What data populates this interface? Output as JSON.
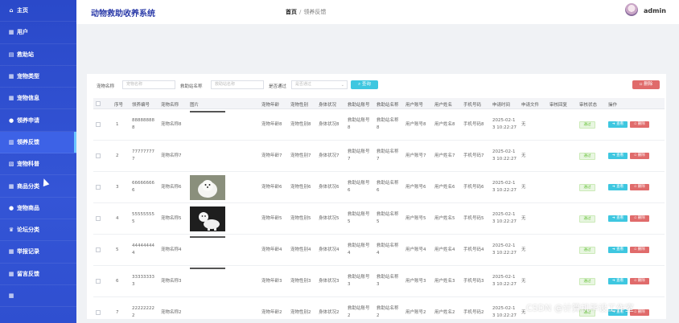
{
  "header": {
    "system_title": "动物救助收养系统",
    "breadcrumb_home": "首页",
    "breadcrumb_sep": "/",
    "breadcrumb_current": "领养反馈",
    "username": "admin"
  },
  "sidebar": {
    "items": [
      {
        "label": "主页",
        "icon": "home-icon"
      },
      {
        "label": "用户",
        "icon": "grid-icon"
      },
      {
        "label": "救助站",
        "icon": "building-icon"
      },
      {
        "label": "宠物类型",
        "icon": "grid-icon"
      },
      {
        "label": "宠物信息",
        "icon": "grid-icon"
      },
      {
        "label": "领养申请",
        "icon": "user-icon"
      },
      {
        "label": "领养反馈",
        "icon": "chart-icon"
      },
      {
        "label": "宠物科普",
        "icon": "book-icon"
      },
      {
        "label": "商品分类",
        "icon": "grid-icon"
      },
      {
        "label": "宠物商品",
        "icon": "user-icon"
      },
      {
        "label": "论坛分类",
        "icon": "trophy-icon"
      },
      {
        "label": "举报记录",
        "icon": "grid-icon"
      },
      {
        "label": "留言反馈",
        "icon": "grid-icon"
      },
      {
        "label": "",
        "icon": "grid-icon"
      }
    ],
    "active_index": 6
  },
  "search": {
    "label1": "宠物名称",
    "placeholder1": "宠物名称",
    "label2": "救助站名称",
    "placeholder2": "救助站名称",
    "label3": "是否通过",
    "select_placeholder": "是否通过",
    "search_btn": "查询",
    "delete_btn": "删除"
  },
  "table": {
    "columns": [
      "序号",
      "领养编号",
      "宠物名称",
      "图片",
      "宠物年龄",
      "宠物性别",
      "身体状况",
      "救助站账号",
      "救助站名称",
      "用户账号",
      "用户姓名",
      "手机号码",
      "申请时间",
      "申请文件",
      "审核回复",
      "审核状态",
      "操作"
    ],
    "view_label": "查看",
    "delete_label": "删除",
    "rows": [
      {
        "idx": "1",
        "code1": "88888888",
        "code2": "8",
        "pet": "宠物名称8",
        "img": "bar",
        "age": "宠物年龄8",
        "sex": "宠物性别8",
        "health": "身体状况8",
        "st1": "救助站账号",
        "st2": "8",
        "sn1": "救助站名称",
        "sn2": "8",
        "uacc": "用户账号8",
        "uname": "用户姓名8",
        "phone": "手机号码8",
        "t1": "2025-02-1",
        "t2": "3 10:22:27",
        "file": "无",
        "status": "通过"
      },
      {
        "idx": "2",
        "code1": "77777777",
        "code2": "7",
        "pet": "宠物名称7",
        "img": "none",
        "age": "宠物年龄7",
        "sex": "宠物性别7",
        "health": "身体状况7",
        "st1": "救助站账号",
        "st2": "7",
        "sn1": "救助站名称",
        "sn2": "7",
        "uacc": "用户账号7",
        "uname": "用户姓名7",
        "phone": "手机号码7",
        "t1": "2025-02-1",
        "t2": "3 10:22:27",
        "file": "无",
        "status": "通过"
      },
      {
        "idx": "3",
        "code1": "66666666",
        "code2": "6",
        "pet": "宠物名称6",
        "img": "dog",
        "age": "宠物年龄6",
        "sex": "宠物性别6",
        "health": "身体状况6",
        "st1": "救助站账号",
        "st2": "6",
        "sn1": "救助站名称",
        "sn2": "6",
        "uacc": "用户账号6",
        "uname": "用户姓名6",
        "phone": "手机号码6",
        "t1": "2025-02-1",
        "t2": "3 10:22:27",
        "file": "无",
        "status": "通过"
      },
      {
        "idx": "4",
        "code1": "55555555",
        "code2": "5",
        "pet": "宠物名称5",
        "img": "dog2",
        "age": "宠物年龄5",
        "sex": "宠物性别5",
        "health": "身体状况5",
        "st1": "救助站账号",
        "st2": "5",
        "sn1": "救助站名称",
        "sn2": "5",
        "uacc": "用户账号5",
        "uname": "用户姓名5",
        "phone": "手机号码5",
        "t1": "2025-02-1",
        "t2": "3 10:22:27",
        "file": "无",
        "status": "通过"
      },
      {
        "idx": "5",
        "code1": "44444444",
        "code2": "4",
        "pet": "宠物名称4",
        "img": "bar",
        "age": "宠物年龄4",
        "sex": "宠物性别4",
        "health": "身体状况4",
        "st1": "救助站账号",
        "st2": "4",
        "sn1": "救助站名称",
        "sn2": "4",
        "uacc": "用户账号4",
        "uname": "用户姓名4",
        "phone": "手机号码4",
        "t1": "2025-02-1",
        "t2": "3 10:22:27",
        "file": "无",
        "status": "通过"
      },
      {
        "idx": "6",
        "code1": "33333333",
        "code2": "3",
        "pet": "宠物名称3",
        "img": "bar",
        "age": "宠物年龄3",
        "sex": "宠物性别3",
        "health": "身体状况3",
        "st1": "救助站账号",
        "st2": "3",
        "sn1": "救助站名称",
        "sn2": "3",
        "uacc": "用户账号3",
        "uname": "用户姓名3",
        "phone": "手机号码3",
        "t1": "2025-02-1",
        "t2": "3 10:22:27",
        "file": "无",
        "status": "通过"
      },
      {
        "idx": "7",
        "code1": "22222222",
        "code2": "2",
        "pet": "宠物名称2",
        "img": "none",
        "age": "宠物年龄2",
        "sex": "宠物性别2",
        "health": "身体状况2",
        "st1": "救助站账号",
        "st2": "2",
        "sn1": "救助站名称",
        "sn2": "2",
        "uacc": "用户账号2",
        "uname": "用户姓名2",
        "phone": "手机号码2",
        "t1": "2025-02-1",
        "t2": "3 10:22:27",
        "file": "无",
        "status": "通过"
      }
    ]
  },
  "watermark": "CSDN @计算机毕设工作室",
  "colors": {
    "sidebar": "#2f4fd0",
    "accent_cyan": "#3ec7e0",
    "danger": "#e06b6b",
    "success": "#67c23a"
  }
}
